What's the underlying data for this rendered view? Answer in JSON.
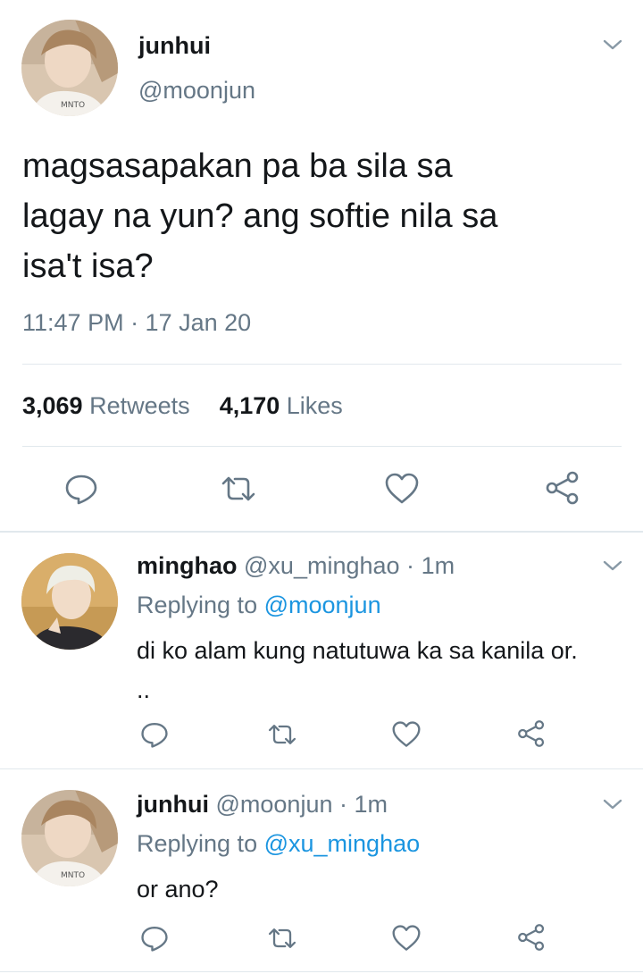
{
  "main_tweet": {
    "name": "junhui",
    "handle": "@moonjun",
    "text_lines": [
      "magsasapakan pa ba sila sa",
      "lagay na yun? ang softie nila sa",
      "isa't isa?"
    ],
    "timestamp": "11:47 PM · 17 Jan 20",
    "retweet_count": "3,069",
    "retweet_label": "Retweets",
    "like_count": "4,170",
    "like_label": "Likes",
    "avatar_icon": "user-photo-avatar"
  },
  "replies": [
    {
      "name": "minghao",
      "handle": "@xu_minghao",
      "dot": "·",
      "time": "1m",
      "replying_label": "Replying to",
      "replying_to": "@moonjun",
      "text_lines": [
        "di ko alam kung natutuwa ka sa kanila or.",
        ".."
      ],
      "avatar_icon": "user-photo-avatar"
    },
    {
      "name": "junhui",
      "handle": "@moonjun",
      "dot": "·",
      "time": "1m",
      "replying_label": "Replying to",
      "replying_to": "@xu_minghao",
      "text_lines": [
        "or ano?"
      ],
      "avatar_icon": "user-photo-avatar"
    }
  ],
  "icons": {
    "reply": "reply-icon",
    "retweet": "retweet-icon",
    "like": "heart-icon",
    "share": "share-icon",
    "more": "chevron-down-icon"
  },
  "colors": {
    "link": "#1b95e0",
    "muted": "#657786",
    "text": "#14171a",
    "divider": "#e1e8ed"
  }
}
